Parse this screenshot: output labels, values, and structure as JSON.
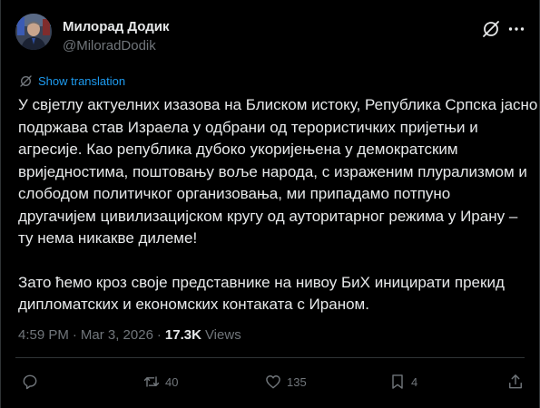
{
  "author": {
    "name": "Милорад Додик",
    "handle": "@MiloradDodik"
  },
  "translate": {
    "label": "Show translation"
  },
  "body": {
    "lines": [
      "У свјетлу актуелних изазова на Блиском истоку, Република Српска јасно",
      "подржава став Израела у одбрани од терористичких пријетњи и",
      "агресије. Као република дубоко укоријењена у демократским",
      "вриједностима, поштовању воље народа, с израженим плурализмом и",
      "слободом политичког организовања, ми припадамо потпуно",
      "другачијем цивилизацијском кругу од ауторитарног режима у Ирану –",
      "ту нема никакве дилеме!",
      "",
      "Зато ћемо кроз своје представнике на нивоу БиХ иницирати прекид",
      "дипломатских и економских контаката с Ираном."
    ]
  },
  "meta": {
    "time": "4:59 PM",
    "separator": "·",
    "date": "Mar 3, 2026",
    "views_count": "17.3K",
    "views_label": "Views"
  },
  "actions": {
    "reply_count": "",
    "repost_count": "40",
    "like_count": "135",
    "bookmark_count": "4"
  },
  "icons": {
    "reply": "reply-icon",
    "repost": "repost-icon",
    "like": "heart-icon",
    "bookmark": "bookmark-icon",
    "share": "share-icon",
    "grok": "grok-icon",
    "more": "more-icon",
    "translate": "translate-icon"
  },
  "colors": {
    "background": "#000000",
    "text": "#e7e9ea",
    "muted": "#71767b",
    "link": "#1d9bf0",
    "border": "#2f3336"
  }
}
